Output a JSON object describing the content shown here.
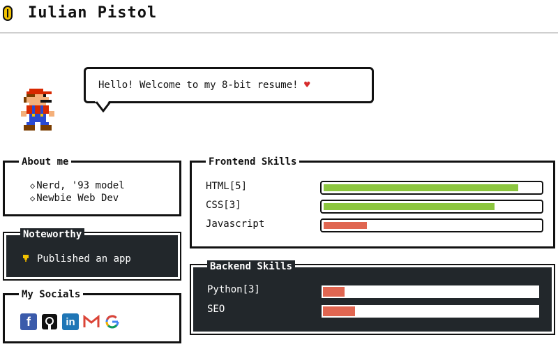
{
  "header": {
    "name": "Iulian Pistol"
  },
  "bubble": {
    "text": "Hello! Welcome to my 8-bit resume!",
    "heart": "♥"
  },
  "about": {
    "title": "About me",
    "items": [
      "Nerd, '93 model",
      "Newbie Web Dev"
    ]
  },
  "noteworthy": {
    "title": "Noteworthy",
    "items": [
      "Published an app"
    ]
  },
  "socials": {
    "title": "My Socials",
    "icons": [
      "facebook-icon",
      "github-icon",
      "linkedin-icon",
      "gmail-icon",
      "google-icon"
    ]
  },
  "frontend": {
    "title": "Frontend Skills",
    "skills": [
      {
        "label": "HTML[5]",
        "level": 0.9,
        "color": "#8cc63f"
      },
      {
        "label": "CSS[3]",
        "level": 0.79,
        "color": "#8cc63f"
      },
      {
        "label": "Javascript",
        "level": 0.2,
        "color": "#e06651"
      }
    ]
  },
  "backend": {
    "title": "Backend Skills",
    "skills": [
      {
        "label": "Python[3]",
        "level": 0.1,
        "color": "#e06651"
      },
      {
        "label": "SEO",
        "level": 0.15,
        "color": "#e06651"
      }
    ]
  }
}
